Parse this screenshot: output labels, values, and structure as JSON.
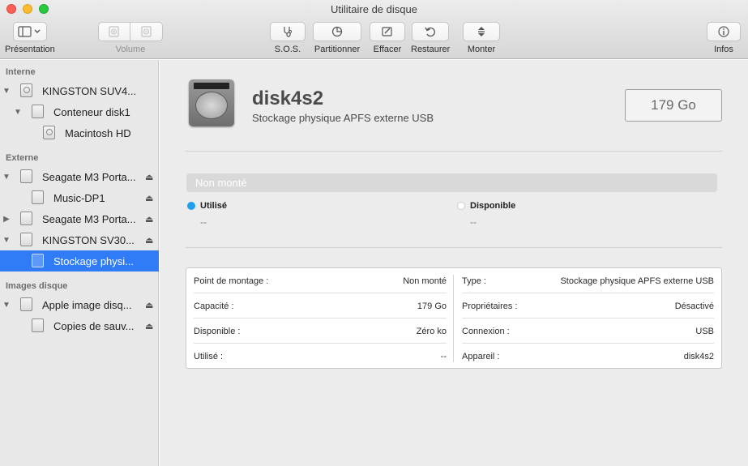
{
  "window": {
    "title": "Utilitaire de disque"
  },
  "toolbar": {
    "presentation": "Présentation",
    "volume": "Volume",
    "sos": "S.O.S.",
    "partition": "Partitionner",
    "erase": "Effacer",
    "restore": "Restaurer",
    "mount": "Monter",
    "info": "Infos"
  },
  "sidebar": {
    "sections": {
      "internal": "Interne",
      "external": "Externe",
      "images": "Images disque"
    },
    "items": [
      {
        "label": "KINGSTON SUV4..."
      },
      {
        "label": "Conteneur disk1"
      },
      {
        "label": "Macintosh HD"
      },
      {
        "label": "Seagate M3 Porta..."
      },
      {
        "label": "Music-DP1"
      },
      {
        "label": "Seagate M3 Porta..."
      },
      {
        "label": "KINGSTON SV30..."
      },
      {
        "label": "Stockage physi..."
      },
      {
        "label": "Apple image disq..."
      },
      {
        "label": "Copies de sauv..."
      }
    ]
  },
  "volume": {
    "name": "disk4s2",
    "description": "Stockage physique APFS externe USB",
    "size": "179 Go",
    "status": "Non monté"
  },
  "usage": {
    "used_label": "Utilisé",
    "used_value": "--",
    "used_color": "#1ea0f0",
    "available_label": "Disponible",
    "available_value": "--",
    "available_color": "#ffffff"
  },
  "info": {
    "left": [
      {
        "key": "Point de montage :",
        "value": "Non monté"
      },
      {
        "key": "Capacité :",
        "value": "179 Go"
      },
      {
        "key": "Disponible :",
        "value": "Zéro ko"
      },
      {
        "key": "Utilisé :",
        "value": "--"
      }
    ],
    "right": [
      {
        "key": "Type :",
        "value": "Stockage physique APFS externe USB"
      },
      {
        "key": "Propriétaires :",
        "value": "Désactivé"
      },
      {
        "key": "Connexion :",
        "value": "USB"
      },
      {
        "key": "Appareil :",
        "value": "disk4s2"
      }
    ]
  }
}
